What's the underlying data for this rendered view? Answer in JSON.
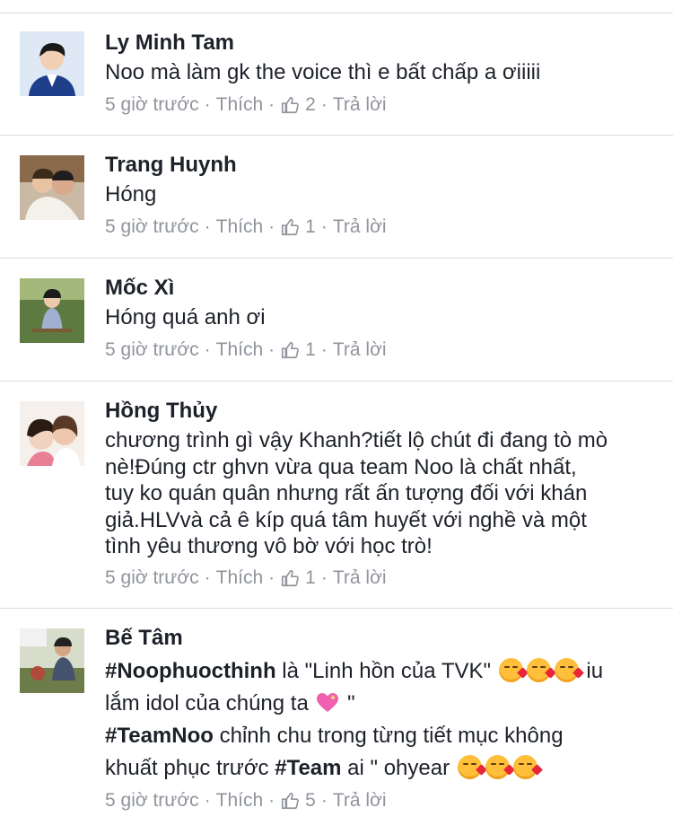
{
  "comments": [
    {
      "author": "Ly Minh Tam",
      "text": "Noo mà làm gk the voice thì e bất chấp a ơiiiii",
      "time": "5 giờ trước",
      "like_label": "Thích",
      "likes": "2",
      "reply_label": "Trả lời",
      "avatar_colors": [
        "#d9e4f2",
        "#1f3f8a"
      ]
    },
    {
      "author": "Trang Huynh",
      "text": "Hóng",
      "time": "5 giờ trước",
      "like_label": "Thích",
      "likes": "1",
      "reply_label": "Trả lời",
      "avatar_colors": [
        "#8b5a3c",
        "#e9e2d7"
      ]
    },
    {
      "author": "Mốc Xì",
      "text": "Hóng quá anh ơi",
      "time": "5 giờ trước",
      "like_label": "Thích",
      "likes": "1",
      "reply_label": "Trả lời",
      "avatar_colors": [
        "#4e6b34",
        "#9aa9c8"
      ]
    },
    {
      "author": "Hồng Thủy",
      "text_lines": [
        "chương trình gì vậy Khanh?tiết lộ chút đi đang tò mò",
        "nè!Đúng ctr ghvn vừa qua team Noo là chất nhất,",
        "tuy ko quán quân nhưng rất ấn tượng đối với khán",
        "giả.HLVvà cả ê kíp quá tâm huyết với nghề và một",
        "tình yêu thương vô bờ với học trò!"
      ],
      "time": "5 giờ trước",
      "like_label": "Thích",
      "likes": "1",
      "reply_label": "Trả lời",
      "avatar_colors": [
        "#f3ddd3",
        "#6b4a3a"
      ]
    },
    {
      "author": "Bế Tâm",
      "hashtags": [
        "#Noophuocthinh",
        "#TeamNoo",
        "#Team"
      ],
      "segments": [
        " là \"Linh hồn của TVK\" ",
        " iu",
        "lắm idol của chúng ta ",
        " \"",
        " chỉnh chu trong từng tiết mục không",
        "khuất phục trước ",
        " ai \" ohyear "
      ],
      "time": "5 giờ trước",
      "like_label": "Thích",
      "likes": "5",
      "reply_label": "Trả lời",
      "avatar_colors": [
        "#7a8a5a",
        "#4a5a78"
      ]
    }
  ],
  "colors": {
    "text": "#1d2129",
    "meta": "#90949c",
    "divider": "#d8dade"
  },
  "icons": {
    "like": "thumbs-up-icon",
    "emoji_kiss": "face-blowing-kiss-icon",
    "emoji_heart": "sparkling-heart-icon"
  }
}
